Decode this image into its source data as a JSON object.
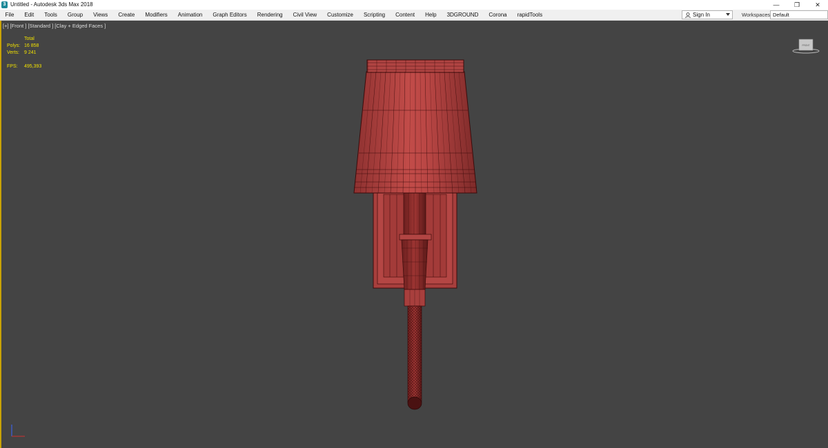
{
  "window": {
    "title": "Untitled - Autodesk 3ds Max 2018",
    "app_icon": "3",
    "minimize": "—",
    "restore": "❐",
    "close": "✕"
  },
  "menu": {
    "items": [
      "File",
      "Edit",
      "Tools",
      "Group",
      "Views",
      "Create",
      "Modifiers",
      "Animation",
      "Graph Editors",
      "Rendering",
      "Civil View",
      "Customize",
      "Scripting",
      "Content",
      "Help",
      "3DGROUND",
      "Corona",
      "rapidTools"
    ],
    "sign_in": "Sign In",
    "workspaces_label": "Workspaces:",
    "workspace_value": "Default"
  },
  "viewport": {
    "label": "[+] [Front ] [Standard ] [Clay + Edged Faces ]",
    "stats": {
      "total_label": "Total",
      "polys_label": "Polys:",
      "polys_value": "16 858",
      "verts_label": "Verts:",
      "verts_value": "9 241",
      "fps_label": "FPS:",
      "fps_value": "495,393"
    },
    "viewcube_face": "FRONT"
  },
  "colors": {
    "titlebar": "#ffffff",
    "menubar": "#f0f0f0",
    "viewport_bg": "#444444",
    "stats_text": "#f0e000",
    "active_border": "#c9a200",
    "model_fill": "#b5413f",
    "wire": "#3b0b0b"
  }
}
